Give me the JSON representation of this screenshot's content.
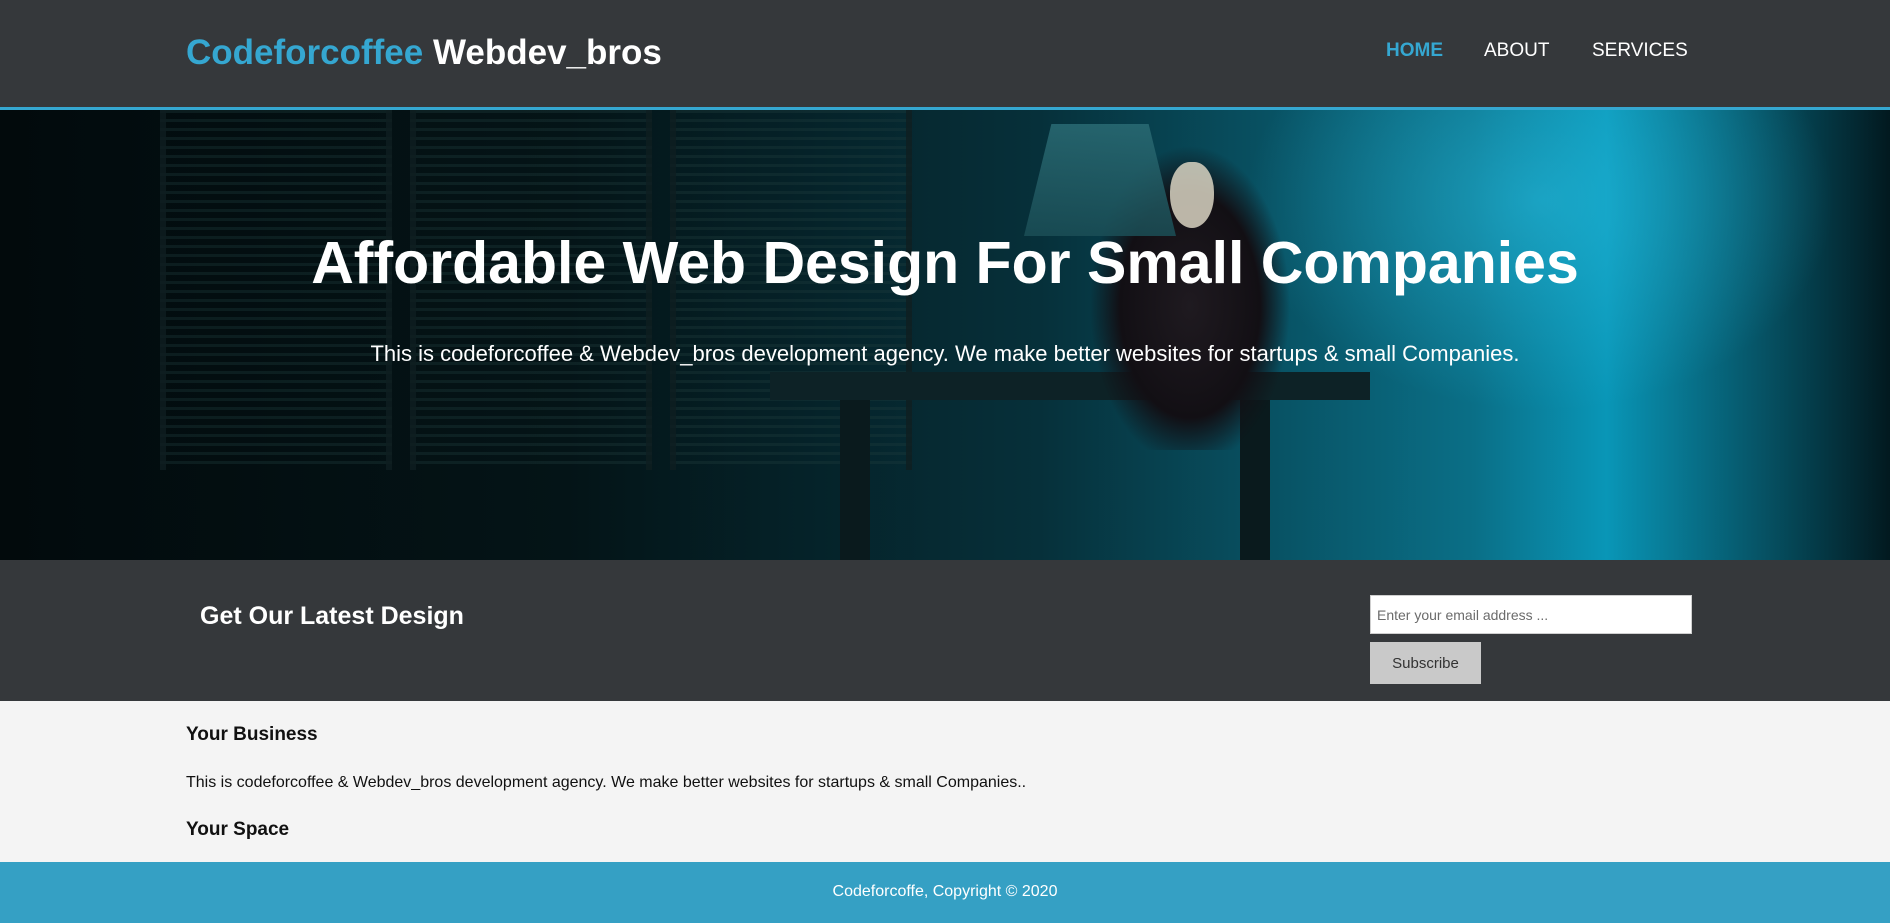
{
  "header": {
    "brand_highlight": "Codeforcoffee",
    "brand_rest": "Webdev_bros",
    "nav": [
      {
        "label": "HOME",
        "active": true
      },
      {
        "label": "ABOUT",
        "active": false
      },
      {
        "label": "SERVICES",
        "active": false
      }
    ]
  },
  "hero": {
    "title": "Affordable Web Design For Small Companies",
    "subtitle": "This is codeforcoffee & Webdev_bros development agency. We make better websites for startups & small Companies."
  },
  "newsletter": {
    "title": "Get Our Latest Design",
    "email_placeholder": "Enter your email address ...",
    "email_value": "",
    "subscribe_label": "Subscribe"
  },
  "sections": [
    {
      "heading": "Your Business",
      "text": "This is codeforcoffee & Webdev_bros development agency. We make better websites for startups & small Companies.."
    },
    {
      "heading": "Your Space"
    }
  ],
  "footer": {
    "text": "Codeforcoffe, Copyright © 2020"
  },
  "colors": {
    "accent": "#35a7d1",
    "header_bg": "#35383b",
    "footer_bg": "#35a0c4",
    "content_bg": "#f4f4f4"
  }
}
